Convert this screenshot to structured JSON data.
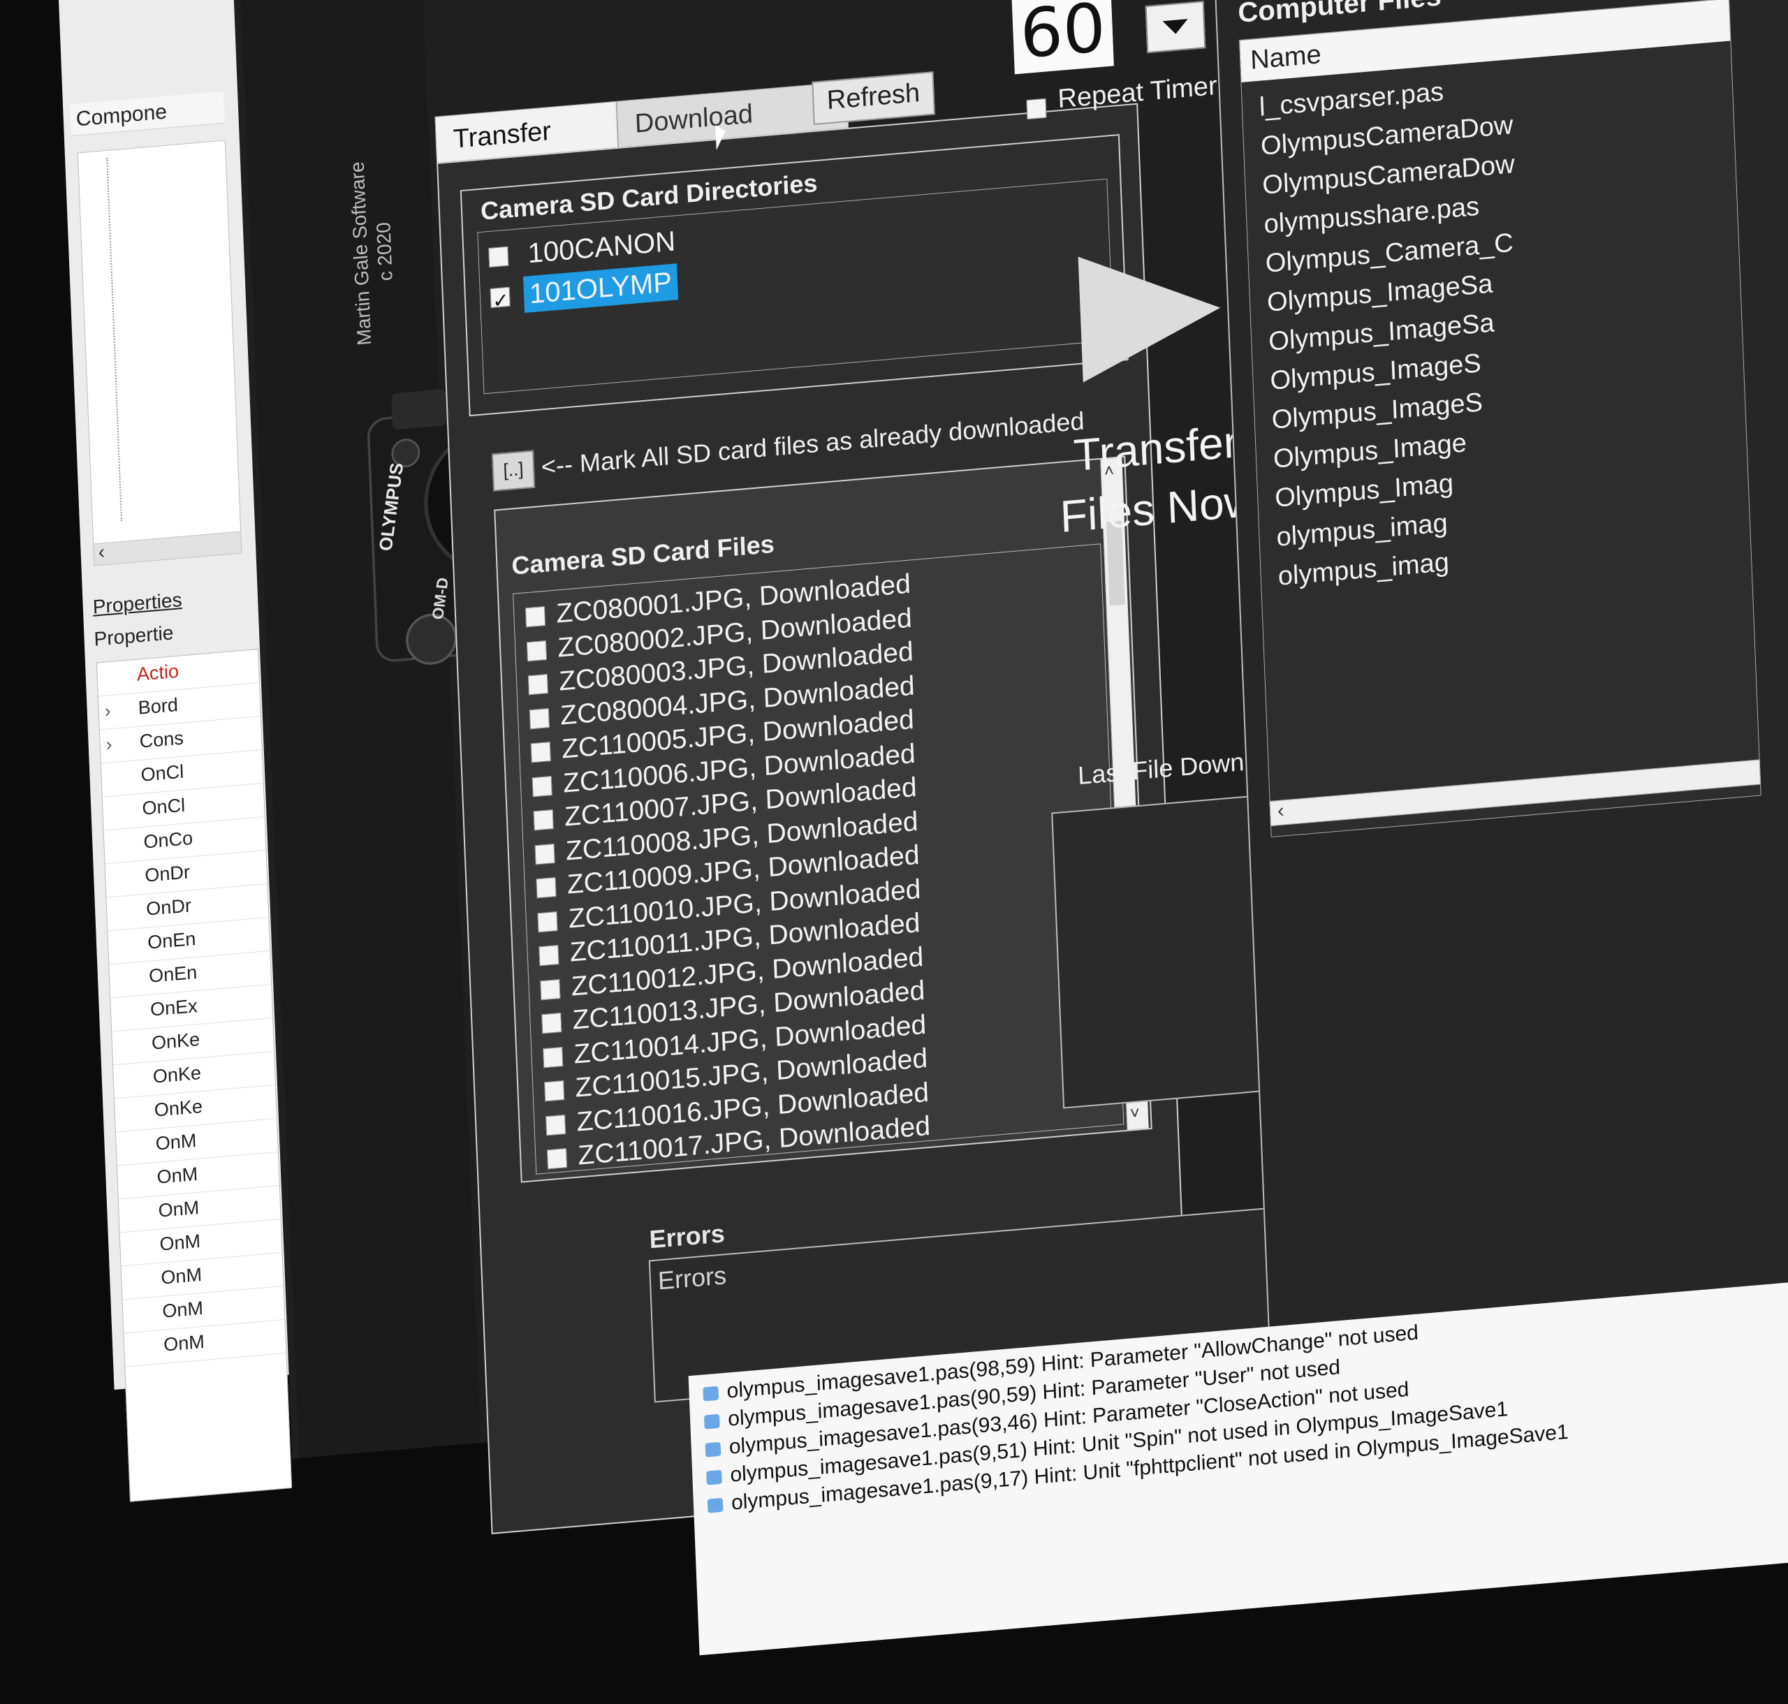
{
  "ide": {
    "components_tab": "Compone",
    "properties_tab1": "Properties",
    "properties_tab2": "Propertie",
    "rows": [
      {
        "exp": "",
        "name": "Actio",
        "red": true
      },
      {
        "exp": "›",
        "name": "Bord",
        "red": false
      },
      {
        "exp": "›",
        "name": "Cons",
        "red": false
      },
      {
        "exp": "",
        "name": "OnCl",
        "red": false
      },
      {
        "exp": "",
        "name": "OnCl",
        "red": false
      },
      {
        "exp": "",
        "name": "OnCo",
        "red": false
      },
      {
        "exp": "",
        "name": "OnDr",
        "red": false
      },
      {
        "exp": "",
        "name": "OnDr",
        "red": false
      },
      {
        "exp": "",
        "name": "OnEn",
        "red": false
      },
      {
        "exp": "",
        "name": "OnEn",
        "red": false
      },
      {
        "exp": "",
        "name": "OnEx",
        "red": false
      },
      {
        "exp": "",
        "name": "OnKe",
        "red": false
      },
      {
        "exp": "",
        "name": "OnKe",
        "red": false
      },
      {
        "exp": "",
        "name": "OnKe",
        "red": false
      },
      {
        "exp": "",
        "name": "OnM",
        "red": false
      },
      {
        "exp": "",
        "name": "OnM",
        "red": false
      },
      {
        "exp": "",
        "name": "OnM",
        "red": false
      },
      {
        "exp": "",
        "name": "OnM",
        "red": false
      },
      {
        "exp": "",
        "name": "OnM",
        "red": false
      },
      {
        "exp": "",
        "name": "OnM",
        "red": false
      },
      {
        "exp": "",
        "name": "OnM",
        "red": false
      }
    ]
  },
  "credit": {
    "line1": "Martin Gale Software",
    "line2": "c 2020"
  },
  "tabs": {
    "transfer": "Transfer Files",
    "history": "Download History"
  },
  "refresh_label": "Refresh",
  "directories": {
    "title": "Camera SD Card Directories",
    "items": [
      {
        "name": "100CANON",
        "checked": false,
        "selected": false
      },
      {
        "name": "101OLYMP",
        "checked": true,
        "selected": true
      }
    ]
  },
  "mark_all": {
    "button": "[..]",
    "label": "<-- Mark All SD card files as already downloaded"
  },
  "files": {
    "title": "Camera SD Card Files",
    "items": [
      "ZC080001.JPG, Downloaded",
      "ZC080002.JPG, Downloaded",
      "ZC080003.JPG, Downloaded",
      "ZC080004.JPG, Downloaded",
      "ZC110005.JPG, Downloaded",
      "ZC110006.JPG, Downloaded",
      "ZC110007.JPG, Downloaded",
      "ZC110008.JPG, Downloaded",
      "ZC110009.JPG, Downloaded",
      "ZC110010.JPG, Downloaded",
      "ZC110011.JPG, Downloaded",
      "ZC110012.JPG, Downloaded",
      "ZC110013.JPG, Downloaded",
      "ZC110014.JPG, Downloaded",
      "ZC110015.JPG, Downloaded",
      "ZC110016.JPG, Downloaded",
      "ZC110017.JPG, Downloaded"
    ]
  },
  "errors": {
    "title": "Errors",
    "placeholder": "Errors"
  },
  "timer": {
    "value": "60",
    "repeat_label": "Repeat Timer"
  },
  "transfer_now": {
    "line1": "Transfer",
    "line2": "Files Now"
  },
  "last_file": {
    "title": "Last File Downloaded"
  },
  "computer_files": {
    "title": "Computer Files",
    "column": "Name",
    "items": [
      "l_csvparser.pas",
      "OlympusCameraDow",
      "OlympusCameraDow",
      "olympusshare.pas",
      "Olympus_Camera_C",
      "Olympus_ImageSa",
      "Olympus_ImageSa",
      "Olympus_ImageS",
      "Olympus_ImageS",
      "Olympus_Image",
      "Olympus_Imag",
      "olympus_imag",
      "olympus_imag"
    ]
  },
  "messages": [
    "olympus_imagesave1.pas(98,59) Hint: Parameter \"AllowChange\" not used",
    "olympus_imagesave1.pas(90,59) Hint: Parameter \"User\" not used",
    "olympus_imagesave1.pas(93,46) Hint: Parameter \"CloseAction\" not used",
    "olympus_imagesave1.pas(9,51) Hint: Unit \"Spin\" not used in Olympus_ImageSave1",
    "olympus_imagesave1.pas(9,17) Hint: Unit \"fphttpclient\" not used in Olympus_ImageSave1"
  ],
  "colors": {
    "selection": "#1e9be3",
    "form_bg": "#2d2d2d",
    "ide_bg": "#ececec"
  }
}
